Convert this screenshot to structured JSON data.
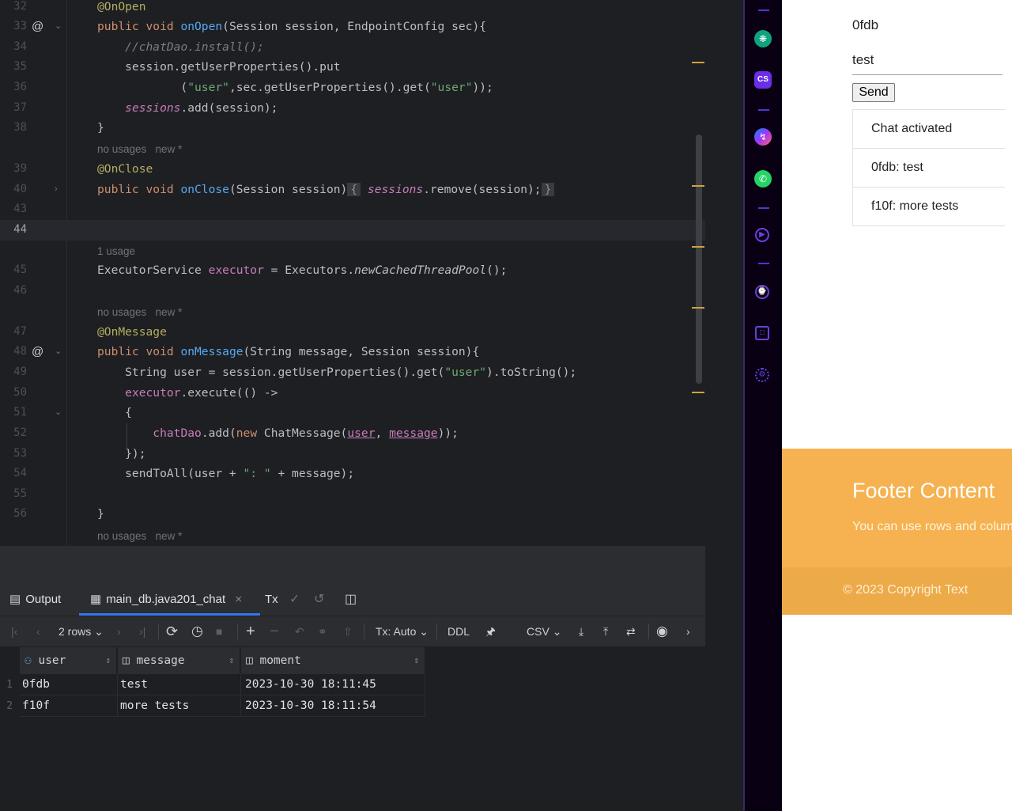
{
  "editor": {
    "lines": [
      {
        "n": "32",
        "html": "<span class='ann'>@OnOpen</span>"
      },
      {
        "n": "33",
        "html": "<span class='kw'>public void </span><span class='decl'>onOpen</span>(Session session, EndpointConfig sec){"
      },
      {
        "n": "34",
        "html": "    <span class='cmt'>//chatDao.install();</span>"
      },
      {
        "n": "35",
        "html": "    session.getUserProperties().put"
      },
      {
        "n": "36",
        "html": "            (<span class='str'>\"user\"</span>,sec.getUserProperties().get(<span class='str'>\"user\"</span>));"
      },
      {
        "n": "37",
        "html": "    <span class='ifld'>sessions</span>.add(session);"
      },
      {
        "n": "38",
        "html": "}"
      },
      {
        "n": "39",
        "html": "<span class='ann'>@OnClose</span>"
      },
      {
        "n": "40",
        "html": "<span class='kw'>public void </span><span class='decl'>onClose</span>(Session session)<span class='fbox'>{</span> <span class='ifld'>sessions</span>.remove(session);<span class='fbox'>}</span>"
      },
      {
        "n": "43",
        "html": ""
      },
      {
        "n": "44",
        "html": ""
      },
      {
        "n": "45",
        "html": "ExecutorService <span class='fld'>executor</span> = Executors.<span class='ital'>newCachedThreadPool</span>();"
      },
      {
        "n": "46",
        "html": ""
      },
      {
        "n": "47",
        "html": "<span class='ann'>@OnMessage</span>"
      },
      {
        "n": "48",
        "html": "<span class='kw'>public void </span><span class='decl'>onMessage</span>(String message, Session session){"
      },
      {
        "n": "49",
        "html": "    String user = session.getUserProperties().get(<span class='str'>\"user\"</span>).toString();"
      },
      {
        "n": "50",
        "html": "    <span class='fld'>executor</span>.execute(() ->"
      },
      {
        "n": "51",
        "html": "    {"
      },
      {
        "n": "52",
        "html": "        <span class='fld'>chatDao</span>.add(<span class='kw'>new </span>ChatMessage(<span class='ul'>user</span>, <span class='ul'>message</span>));"
      },
      {
        "n": "53",
        "html": "    });"
      },
      {
        "n": "54",
        "html": "    sendToAll(user + <span class='str'>\": \"</span> + message);"
      },
      {
        "n": "55",
        "html": ""
      },
      {
        "n": "56",
        "html": "}"
      }
    ],
    "hints": {
      "h1": "no usages   new *",
      "h2": "1 usage",
      "h3": "no usages   new *",
      "h4": "no usages   new *"
    }
  },
  "panel": {
    "tab_output": "Output",
    "tab_db": "main_db.java201_chat",
    "tab_tx": "Tx",
    "rows_label": "2 rows",
    "tx_mode": "Tx: Auto",
    "ddl": "DDL",
    "csv": "CSV",
    "columns": [
      "user",
      "message",
      "moment"
    ],
    "rows": [
      {
        "n": "1",
        "user": "0fdb",
        "message": "test",
        "moment": "2023-10-30 18:11:45"
      },
      {
        "n": "2",
        "user": "f10f",
        "message": "more tests",
        "moment": "2023-10-30 18:11:54"
      }
    ]
  },
  "web": {
    "name_label": "0fdb",
    "message_value": "test",
    "send_label": "Send",
    "chat_items": [
      "Chat activated",
      "0fdb: test",
      "f10f: more tests"
    ],
    "footer_title": "Footer Content",
    "footer_sub": "You can use rows and colum",
    "copyright": "© 2023 Copyright Text"
  },
  "colors": {
    "footer": "#f6b250",
    "footer_bottom": "#edaa48",
    "ide_bg": "#1e1f22",
    "accent": "#3574f0"
  }
}
